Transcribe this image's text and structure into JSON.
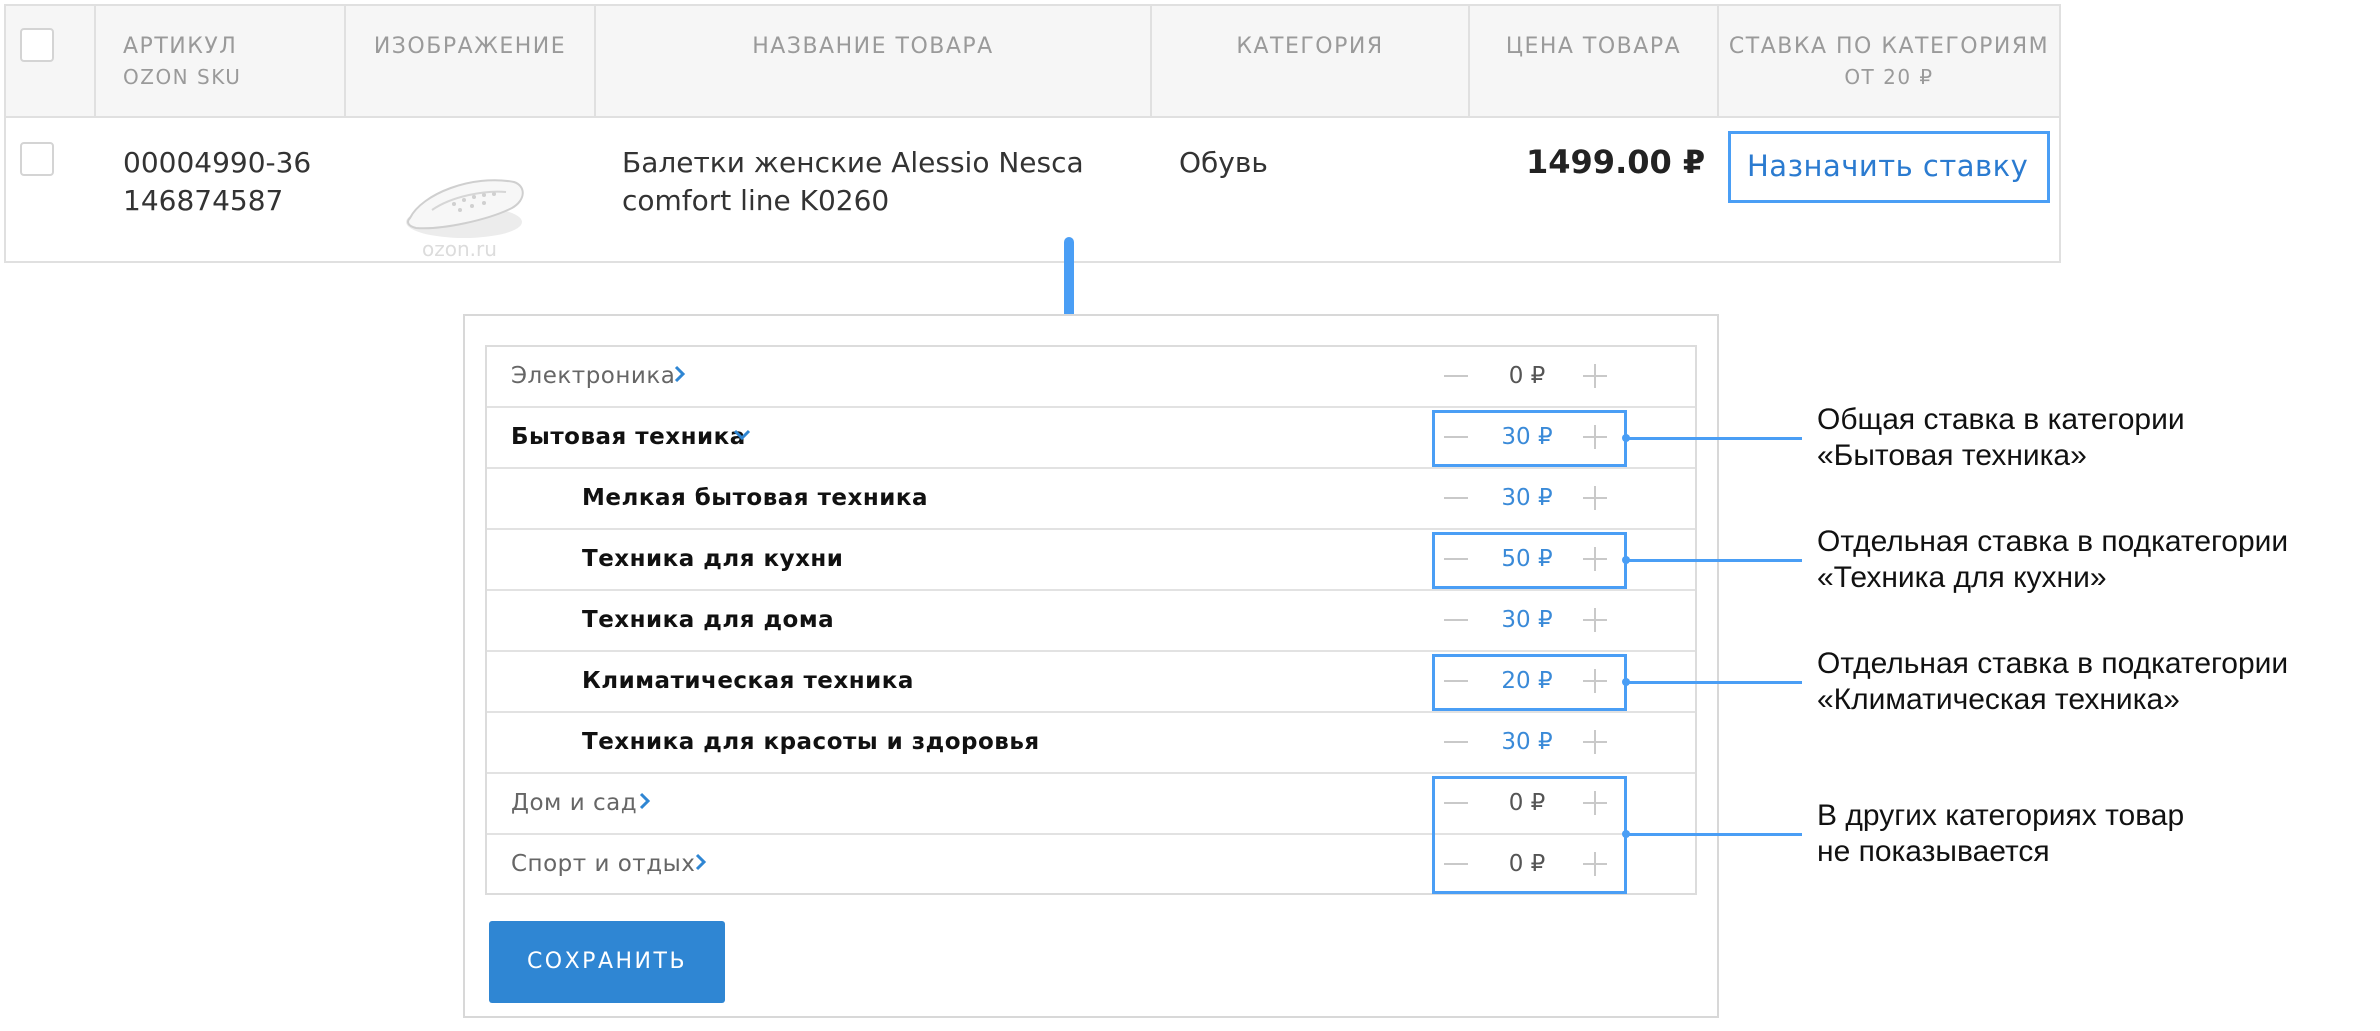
{
  "table": {
    "headers": {
      "article": "АРТИКУЛ",
      "article_sub": "OZON SKU",
      "image": "ИЗОБРАЖЕНИЕ",
      "name": "НАЗВАНИЕ ТОВАРА",
      "category": "КАТЕГОРИЯ",
      "price": "ЦЕНА ТОВАРА",
      "rate": "СТАВКА ПО КАТЕГОРИЯМ",
      "rate_sub": "ОТ 20 ₽"
    },
    "row": {
      "article": "00004990-36",
      "sku": "146874587",
      "image_watermark": "ozon.ru",
      "name_line1": "Балетки женские Alessio Nesca",
      "name_line2": "comfort line K0260",
      "category": "Обувь",
      "price": "1499.00 ₽",
      "assign_button": "Назначить ставку"
    }
  },
  "categories": [
    {
      "label": "Электроника",
      "value": "0 ₽",
      "level": "top",
      "chevron": "right"
    },
    {
      "label": "Бытовая техника",
      "value": "30 ₽",
      "level": "top-bold",
      "chevron": "down"
    },
    {
      "label": "Мелкая бытовая техника",
      "value": "30 ₽",
      "level": "sub"
    },
    {
      "label": "Техника для кухни",
      "value": "50 ₽",
      "level": "sub"
    },
    {
      "label": "Техника для дома",
      "value": "30 ₽",
      "level": "sub"
    },
    {
      "label": "Климатическая техника",
      "value": "20 ₽",
      "level": "sub"
    },
    {
      "label": "Техника для красоты и здоровья",
      "value": "30 ₽",
      "level": "sub"
    },
    {
      "label": "Дом и сад",
      "value": "0 ₽",
      "level": "top",
      "chevron": "right"
    },
    {
      "label": "Спорт и отдых",
      "value": "0 ₽",
      "level": "top",
      "chevron": "right"
    }
  ],
  "save_button": "СОХРАНИТЬ",
  "annotations": {
    "a1_line1": "Общая ставка в категории",
    "a1_line2": "«Бытовая техника»",
    "a2_line1": "Отдельная ставка в подкатегории",
    "a2_line2": "«Техника для кухни»",
    "a3_line1": "Отдельная ставка в подкатегории",
    "a3_line2": "«Климатическая техника»",
    "a4_line1": "В других категориях товар",
    "a4_line2": "не показывается"
  },
  "colors": {
    "accent": "#4a9ef5",
    "link": "#2b7bd0",
    "button": "#2f86d3"
  }
}
